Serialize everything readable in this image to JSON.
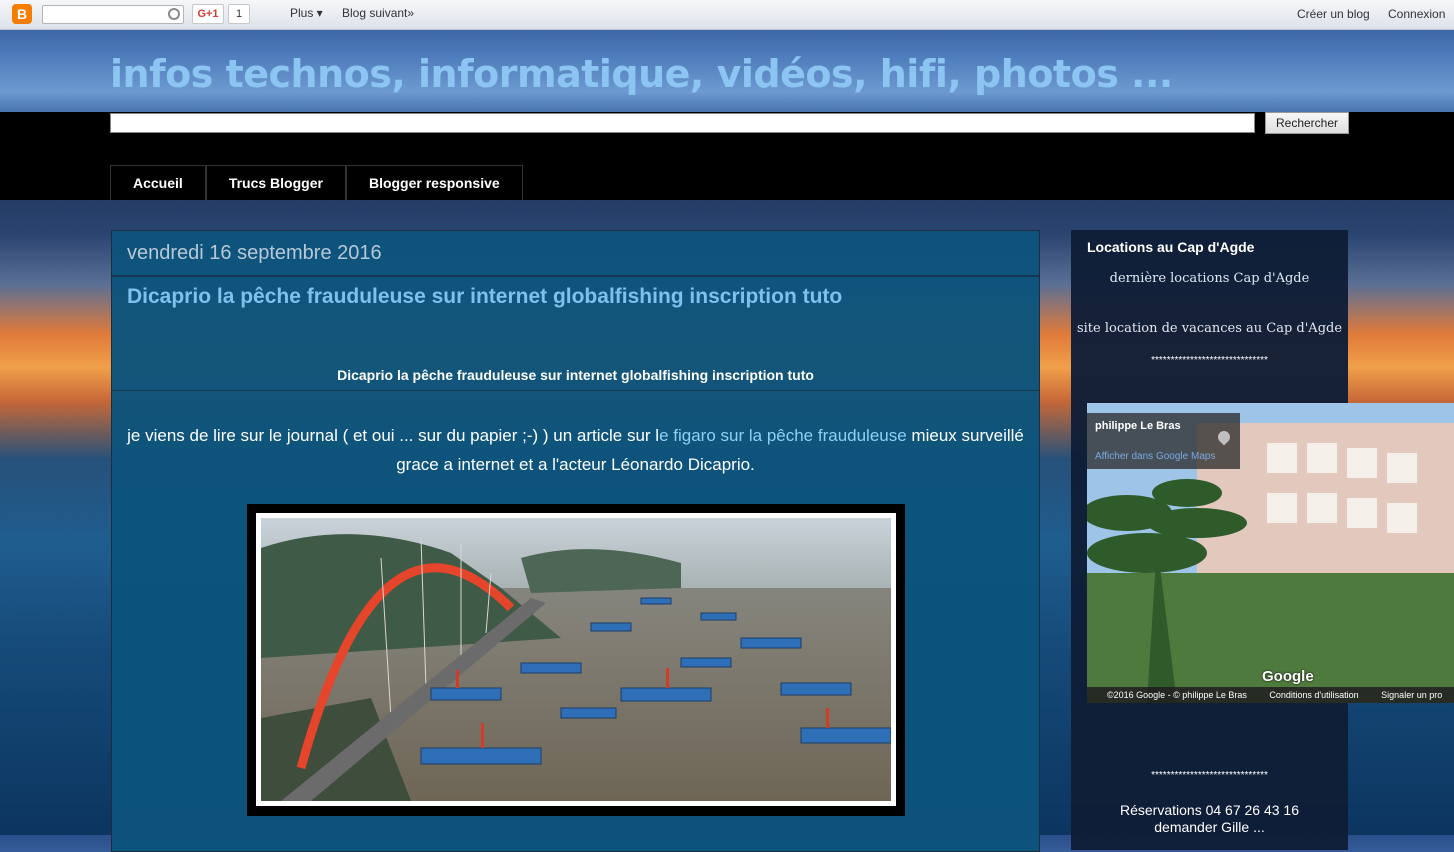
{
  "navbar": {
    "logo": "B",
    "gplus": "G+1",
    "gcount": "1",
    "plus": "Plus ▾",
    "next_blog": "Blog suivant»",
    "create_blog": "Créer un blog",
    "login": "Connexion"
  },
  "header": {
    "title": "infos technos, informatique, vidéos, hifi, photos ...",
    "search_button": "Rechercher"
  },
  "tabs": [
    "Accueil",
    "Trucs Blogger",
    "Blogger responsive"
  ],
  "post": {
    "date": "vendredi 16 septembre 2016",
    "title": "Dicaprio la pêche frauduleuse sur internet globalfishing inscription tuto",
    "subtitle": "Dicaprio la pêche frauduleuse sur internet globalfishing inscription tuto",
    "body_before": "je viens de lire sur le journal ( et oui ... sur du papier ;-) ) un article sur l",
    "body_link": "e figaro sur la pêche frauduleuse",
    "body_after": " mieux surveillé grace a internet et a l'acteur Léonardo Dicaprio."
  },
  "sidebar": {
    "title": "Locations au Cap d'Agde",
    "link1": "dernière locations Cap d'Agde",
    "link2": "site location de vacances au Cap d'Agde",
    "stars": "******************************",
    "map": {
      "owner": "philippe Le Bras",
      "open_link": "Afficher dans Google Maps",
      "google": "Google",
      "footer_copy": "©2016 Google - © philippe Le Bras",
      "footer_terms": "Conditions d'utilisation",
      "footer_report": "Signaler un pro"
    },
    "reserve_line1": "Réservations 04 67 26 43 16",
    "reserve_line2": "demander Gille ..."
  },
  "colors": {
    "title": "#8cc4f2",
    "post_title": "#7fc0ee",
    "main_bg": "#0c547c",
    "sidebar_bg": "#0f1e37"
  }
}
